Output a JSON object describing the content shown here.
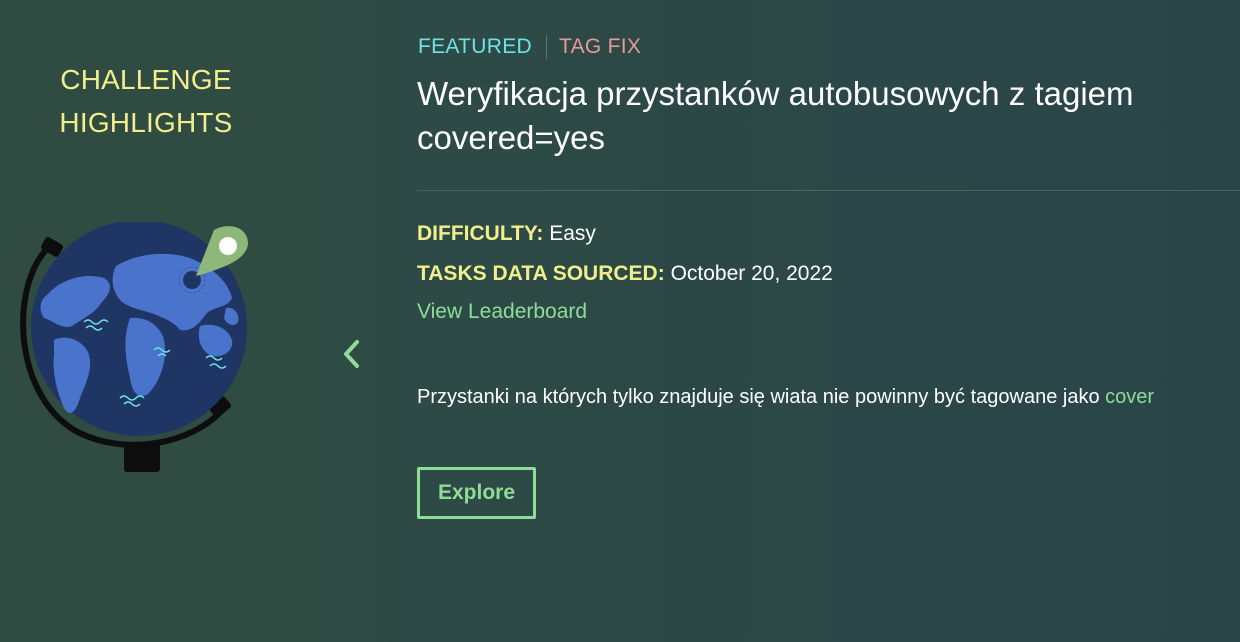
{
  "sidebar": {
    "title_line1": "CHALLENGE",
    "title_line2": "HIGHLIGHTS"
  },
  "challenge": {
    "tags": {
      "featured": "FEATURED",
      "type": "TAG FIX"
    },
    "title": "Weryfikacja przystanków autobusowych z tagiem covered=yes",
    "difficulty_label": "DIFFICULTY:",
    "difficulty_value": "Easy",
    "sourced_label": "TASKS DATA SOURCED:",
    "sourced_value": "October 20, 2022",
    "leaderboard_link": "View Leaderboard",
    "description_text": "Przystanki na których tylko znajduje się wiata nie powinny być tagowane jako ",
    "description_code": "cover",
    "explore_label": "Explore"
  },
  "icons": {
    "prev": "chevron-left-icon",
    "illustration": "globe-icon",
    "pin": "map-pin-icon"
  },
  "colors": {
    "accent_yellow": "#f2ee8c",
    "accent_green": "#8fdc96",
    "featured_cyan": "#6fe2e6",
    "tag_fix_pink": "#e79a98",
    "background": "#2f4b42"
  }
}
